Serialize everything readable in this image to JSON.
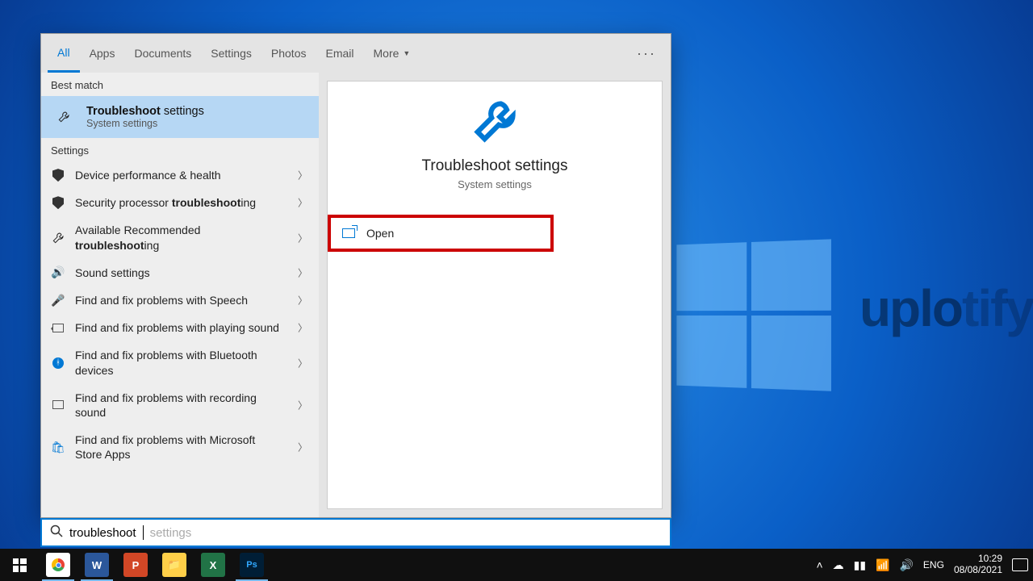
{
  "tabs": {
    "all": "All",
    "apps": "Apps",
    "documents": "Documents",
    "settings": "Settings",
    "photos": "Photos",
    "email": "Email",
    "more": "More"
  },
  "section": {
    "best": "Best match",
    "settings": "Settings"
  },
  "best": {
    "title_prefix": "Troubleshoot",
    "title_rest": " settings",
    "sub": "System settings"
  },
  "items": {
    "i0": "Device performance & health",
    "i1_a": "Security processor ",
    "i1_b": "troubleshoot",
    "i1_c": "ing",
    "i2_a": "Available Recommended ",
    "i2_b": "troubleshoot",
    "i2_c": "ing",
    "i3": "Sound settings",
    "i4": "Find and fix problems with Speech",
    "i5": "Find and fix problems with playing sound",
    "i6": "Find and fix problems with Bluetooth devices",
    "i7": "Find and fix problems with recording sound",
    "i8": "Find and fix problems with Microsoft Store Apps"
  },
  "preview": {
    "title": "Troubleshoot settings",
    "sub": "System settings",
    "open": "Open"
  },
  "search": {
    "typed": "troubleshoot",
    "suggest": " settings"
  },
  "tray": {
    "lang": "ENG",
    "time": "10:29",
    "date": "08/08/2021"
  },
  "watermark": {
    "a": "uplo",
    "b": "tify"
  }
}
